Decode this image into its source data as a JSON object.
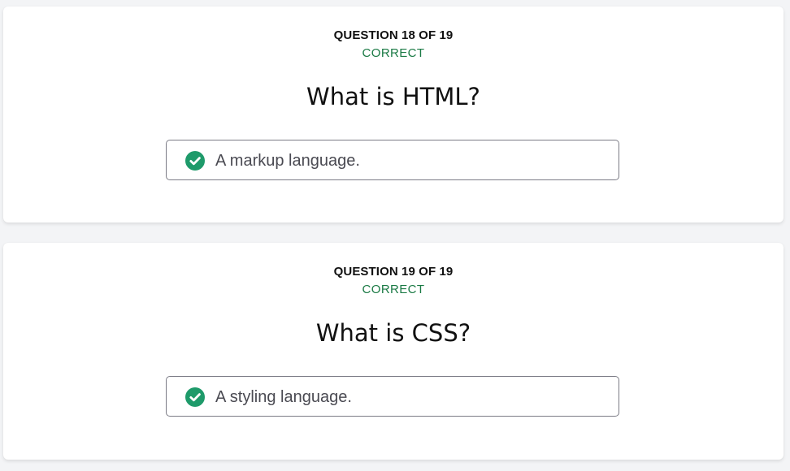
{
  "colors": {
    "page_bg": "#f3f4f6",
    "card_bg": "#ffffff",
    "correct_green": "#1b7a45",
    "check_green": "#1e9a6a",
    "answer_border": "#7b7b85"
  },
  "questions": [
    {
      "counter": "QUESTION 18 OF 19",
      "status": "CORRECT",
      "question": "What is HTML?",
      "answer": "A markup language.",
      "answer_icon": "check-circle-icon"
    },
    {
      "counter": "QUESTION 19 OF 19",
      "status": "CORRECT",
      "question": "What is CSS?",
      "answer": "A styling language.",
      "answer_icon": "check-circle-icon"
    }
  ]
}
